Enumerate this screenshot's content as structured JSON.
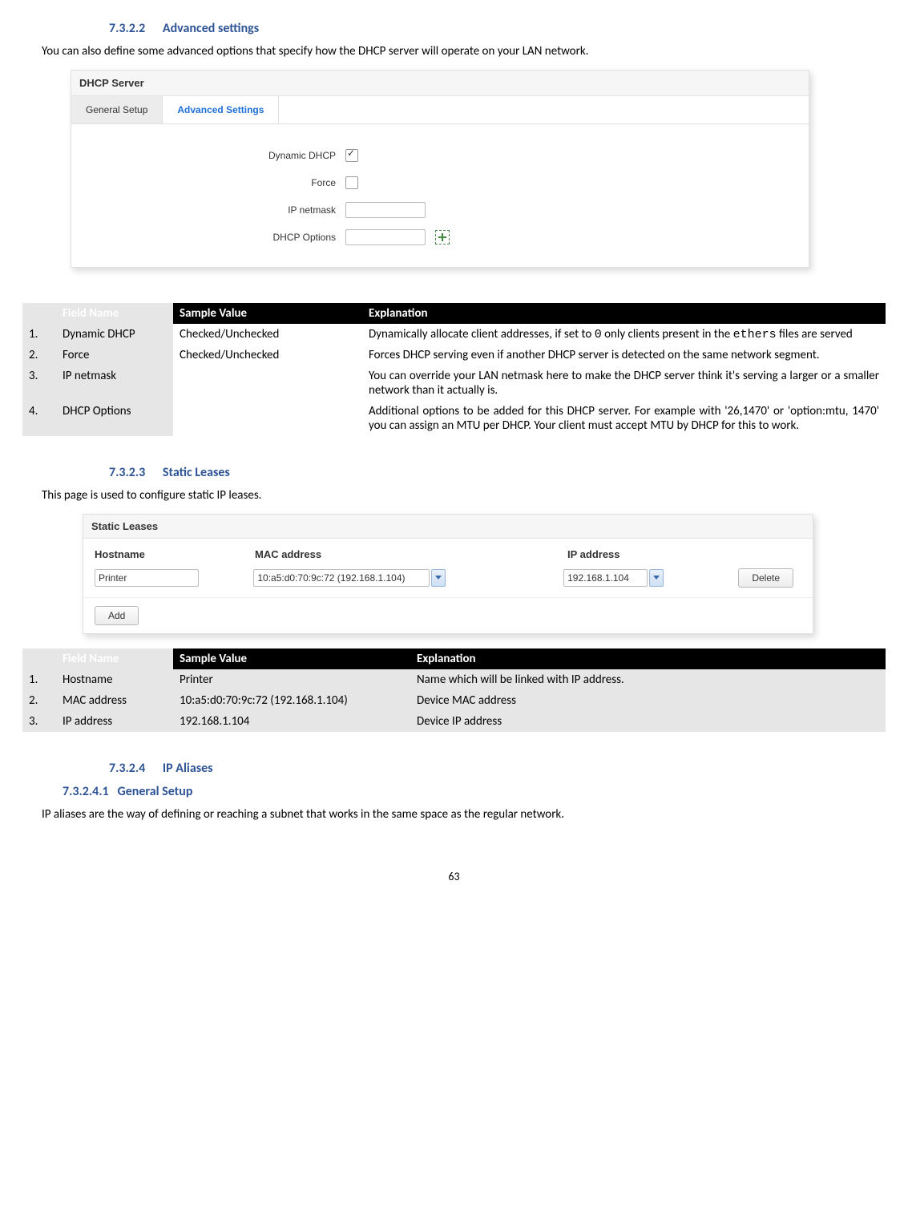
{
  "s1": {
    "num": "7.3.2.2",
    "title": "Advanced settings",
    "intro": "You can also define some advanced options that specify how the DHCP server will operate on your LAN network."
  },
  "dhcp_panel": {
    "title": "DHCP Server",
    "tab_general": "General Setup",
    "tab_advanced": "Advanced Settings",
    "rows": {
      "dynamic": "Dynamic DHCP",
      "force": "Force",
      "netmask": "IP netmask",
      "options": "DHCP Options"
    }
  },
  "table1": {
    "head": {
      "fn": "Field Name",
      "sv": "Sample Value",
      "ex": "Explanation"
    },
    "rows": [
      {
        "n": "1.",
        "fn": "Dynamic DHCP",
        "sv": "Checked/Unchecked",
        "ex_a": "Dynamically allocate client addresses, if set to ",
        "ex_code": "0",
        "ex_b": " only clients present in the ",
        "ex_code2": "ethers",
        "ex_c": " files are served"
      },
      {
        "n": "2.",
        "fn": "Force",
        "sv": "Checked/Unchecked",
        "ex": "Forces DHCP serving even if another DHCP server is detected on the same network segment."
      },
      {
        "n": "3.",
        "fn": "IP netmask",
        "sv": "",
        "ex": "You can override your LAN netmask here to make the DHCP server think it's serving a larger or a smaller network than it actually is."
      },
      {
        "n": "4.",
        "fn": "DHCP Options",
        "sv": "",
        "ex": "Additional options to be added for this DHCP server. For example with '26,1470' or 'option:mtu, 1470' you can assign an MTU per DHCP. Your client must accept MTU by DHCP for this to work."
      }
    ]
  },
  "s2": {
    "num": "7.3.2.3",
    "title": "Static Leases",
    "intro": "This page is used to configure static IP leases."
  },
  "leases_panel": {
    "title": "Static Leases",
    "cols": {
      "host": "Hostname",
      "mac": "MAC address",
      "ip": "IP address"
    },
    "row": {
      "host": "Printer",
      "mac": "10:a5:d0:70:9c:72 (192.168.1.104)",
      "ip": "192.168.1.104"
    },
    "delete": "Delete",
    "add": "Add"
  },
  "table2": {
    "head": {
      "fn": "Field Name",
      "sv": "Sample Value",
      "ex": "Explanation"
    },
    "rows": [
      {
        "n": "1.",
        "fn": "Hostname",
        "sv": "Printer",
        "ex": "Name which will be linked with IP address."
      },
      {
        "n": "2.",
        "fn": "MAC address",
        "sv": "10:a5:d0:70:9c:72 (192.168.1.104)",
        "ex": "Device MAC address"
      },
      {
        "n": "3.",
        "fn": "IP address",
        "sv": "192.168.1.104",
        "ex": "Device IP address"
      }
    ]
  },
  "s3": {
    "num": "7.3.2.4",
    "title": "IP Aliases"
  },
  "s4": {
    "num": "7.3.2.4.1",
    "title": "General Setup",
    "intro": "IP aliases are the way of defining or reaching a subnet that works in the same space as the regular network."
  },
  "page": "63"
}
